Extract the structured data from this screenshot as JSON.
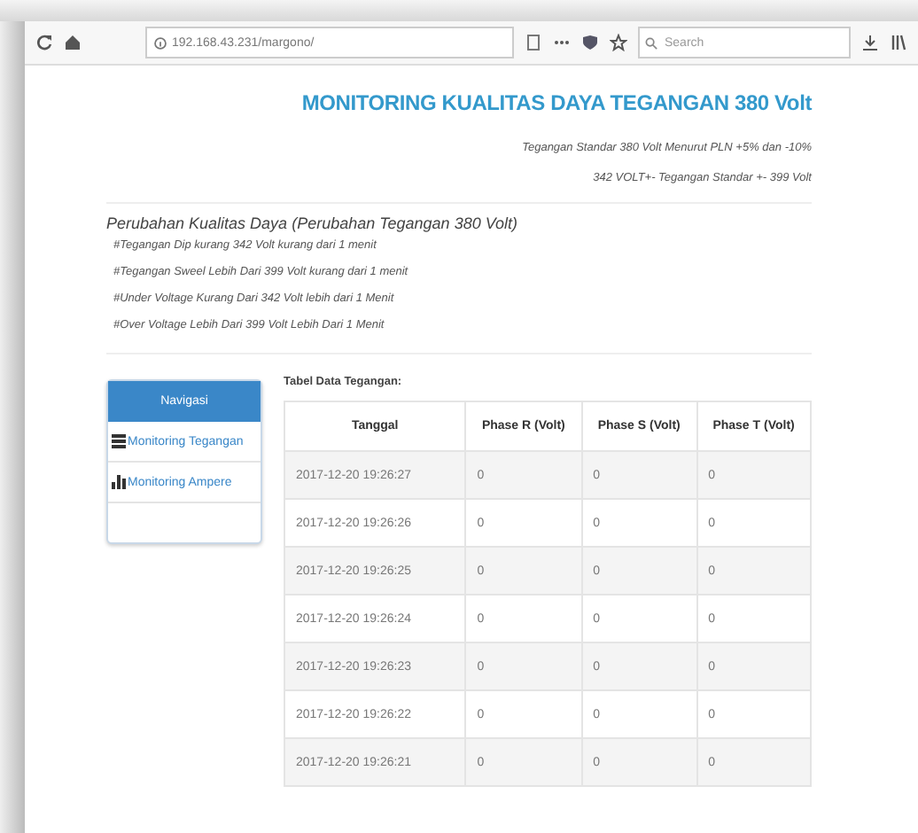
{
  "browser": {
    "url": "192.168.43.231/margono/",
    "search": {
      "placeholder": "Search"
    }
  },
  "title": "MONITORING KUALITAS DAYA TEGANGAN 380 Volt",
  "standard_lines": [
    "Tegangan Standar 380 Volt Menurut PLN +5% dan -10%",
    "342 VOLT+- Tegangan Standar +- 399 Volt"
  ],
  "section_heading": "Perubahan Kualitas Daya (Perubahan Tegangan 380 Volt)",
  "notes": [
    "#Tegangan Dip kurang 342 Volt kurang dari 1 menit",
    "#Tegangan Sweel Lebih Dari 399 Volt kurang dari 1 menit",
    "#Under Voltage Kurang Dari 342 Volt lebih dari 1 Menit",
    "#Over Voltage Lebih Dari 399 Volt Lebih Dari 1 Menit"
  ],
  "nav": {
    "title": "Navigasi",
    "items": [
      {
        "label": "Monitoring Tegangan",
        "kind": "table"
      },
      {
        "label": "Monitoring Ampere",
        "kind": "chart"
      }
    ]
  },
  "table": {
    "caption": "Tabel Data Tegangan:",
    "columns": [
      "Tanggal",
      "Phase R (Volt)",
      "Phase S (Volt)",
      "Phase T (Volt)"
    ],
    "rows": [
      [
        "2017-12-20 19:26:27",
        "0",
        "0",
        "0"
      ],
      [
        "2017-12-20 19:26:26",
        "0",
        "0",
        "0"
      ],
      [
        "2017-12-20 19:26:25",
        "0",
        "0",
        "0"
      ],
      [
        "2017-12-20 19:26:24",
        "0",
        "0",
        "0"
      ],
      [
        "2017-12-20 19:26:23",
        "0",
        "0",
        "0"
      ],
      [
        "2017-12-20 19:26:22",
        "0",
        "0",
        "0"
      ],
      [
        "2017-12-20 19:26:21",
        "0",
        "0",
        "0"
      ]
    ]
  }
}
